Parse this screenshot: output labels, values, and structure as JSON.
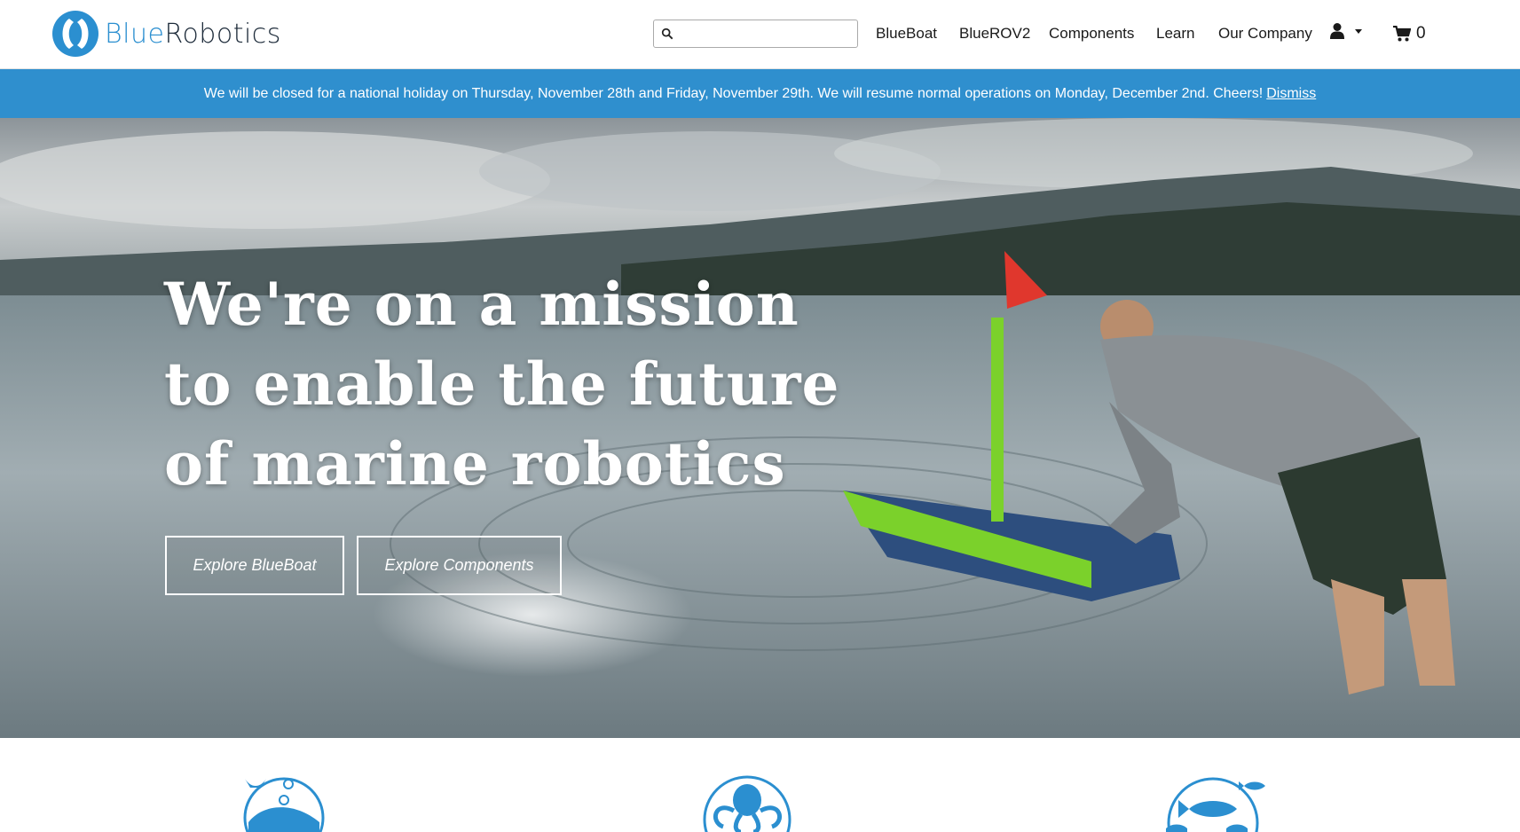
{
  "brand": {
    "name_part1": "Blue",
    "name_part2": "Robotics",
    "color": "#2b8fd0"
  },
  "search": {
    "placeholder": "",
    "icon": "search-icon"
  },
  "nav": {
    "items": [
      {
        "label": "BlueBoat"
      },
      {
        "label": "BlueROV2"
      },
      {
        "label": "Components"
      },
      {
        "label": "Learn"
      },
      {
        "label": "Our Company"
      }
    ],
    "account_icon": "user-icon",
    "caret_icon": "caret-down-icon",
    "cart_icon": "cart-icon",
    "cart_count": "0"
  },
  "banner": {
    "message": "We will be closed for a national holiday on Thursday, November 28th and Friday, November 29th. We will resume normal operations on Monday, December 2nd. Cheers!",
    "dismiss_label": "Dismiss",
    "background": "#2f8fce"
  },
  "hero": {
    "title_lines": [
      "We're on a mission",
      "to enable the future",
      "of marine robotics"
    ],
    "buttons": [
      {
        "label": "Explore BlueBoat"
      },
      {
        "label": "Explore Components"
      }
    ]
  },
  "features": {
    "icons": [
      "whale-icon",
      "octopus-icon",
      "fish-icon"
    ],
    "accent": "#2b8fd0"
  }
}
